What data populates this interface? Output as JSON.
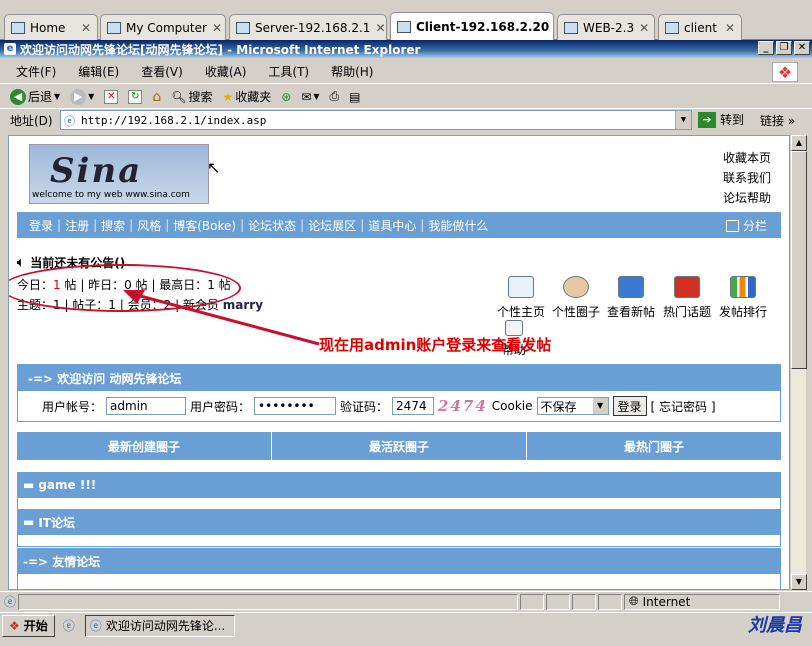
{
  "vm_tabs": [
    {
      "label": "Home",
      "icon": "home-icon"
    },
    {
      "label": "My Computer",
      "icon": "computer-icon"
    },
    {
      "label": "Server-192.168.2.1",
      "icon": "vm-icon"
    },
    {
      "label": "Client-192.168.2.20",
      "icon": "vm-icon"
    },
    {
      "label": "WEB-2.3",
      "icon": "vm-icon"
    },
    {
      "label": "client",
      "icon": "vm-icon"
    }
  ],
  "window": {
    "title": "欢迎访问动网先锋论坛[动网先锋论坛] - Microsoft Internet Explorer"
  },
  "menu": [
    "文件(F)",
    "编辑(E)",
    "查看(V)",
    "收藏(A)",
    "工具(T)",
    "帮助(H)"
  ],
  "toolbar": {
    "back": "后退",
    "search": "搜索",
    "favorites": "收藏夹"
  },
  "address": {
    "label": "地址(D)",
    "url": "http://192.168.2.1/index.asp",
    "go": "转到",
    "links": "链接"
  },
  "site": {
    "logo_text": "Sina",
    "logo_sub": "welcome to my web www.sina.com",
    "top_links": [
      "收藏本页",
      "联系我们",
      "论坛帮助"
    ],
    "nav": [
      "登录",
      "注册",
      "搜索",
      "风格",
      "博客(Boke)",
      "论坛状态",
      "论坛展区",
      "道具中心",
      "我能做什么"
    ],
    "nav_right": "分栏",
    "notice": "当前还未有公告()",
    "today_label": "今日：",
    "today_value": "1",
    "today_unit": "帖",
    "yesterday": "昨日：0 帖",
    "highest": "最高日：1 帖",
    "stats2_prefix": "主题：1 | 帖子：1 | 会员：2 | 新会员",
    "new_member": "marry",
    "icons": [
      {
        "label": "个性主页",
        "icon": "home-page-icon"
      },
      {
        "label": "个性圈子",
        "icon": "people-icon"
      },
      {
        "label": "查看新帖",
        "icon": "new-post-icon"
      },
      {
        "label": "热门话题",
        "icon": "hot-topic-icon"
      },
      {
        "label": "发帖排行",
        "icon": "bar-chart-icon"
      },
      {
        "label": "帮助",
        "icon": "help-doc-icon"
      }
    ],
    "annotation": "现在用admin账户登录来查看发帖",
    "login": {
      "header": "-=> 欢迎访问 动网先锋论坛",
      "user_label": "用户帐号：",
      "user_value": "admin",
      "pass_label": "用户密码：",
      "pass_value": "••••••••",
      "code_label": "验证码：",
      "code_value": "2474",
      "captcha": "2474",
      "cookie_label": "Cookie",
      "cookie_value": "不保存",
      "login_button": "登录",
      "forgot": "[ 忘记密码 ]"
    },
    "circle_headers": [
      "最新创建圈子",
      "最活跃圈子",
      "最热门圈子"
    ],
    "forums": [
      "game !!!",
      "IT论坛"
    ],
    "friend_links": "-=> 友情论坛"
  },
  "status": {
    "zone": "Internet"
  },
  "taskbar": {
    "start": "开始",
    "item": "欢迎访问动网先锋论..."
  },
  "watermark": "刘晨昌",
  "colors": {
    "nav_bg": "#6a9fd6",
    "title_bg": "#0a246a",
    "annotation": "#d00000"
  }
}
